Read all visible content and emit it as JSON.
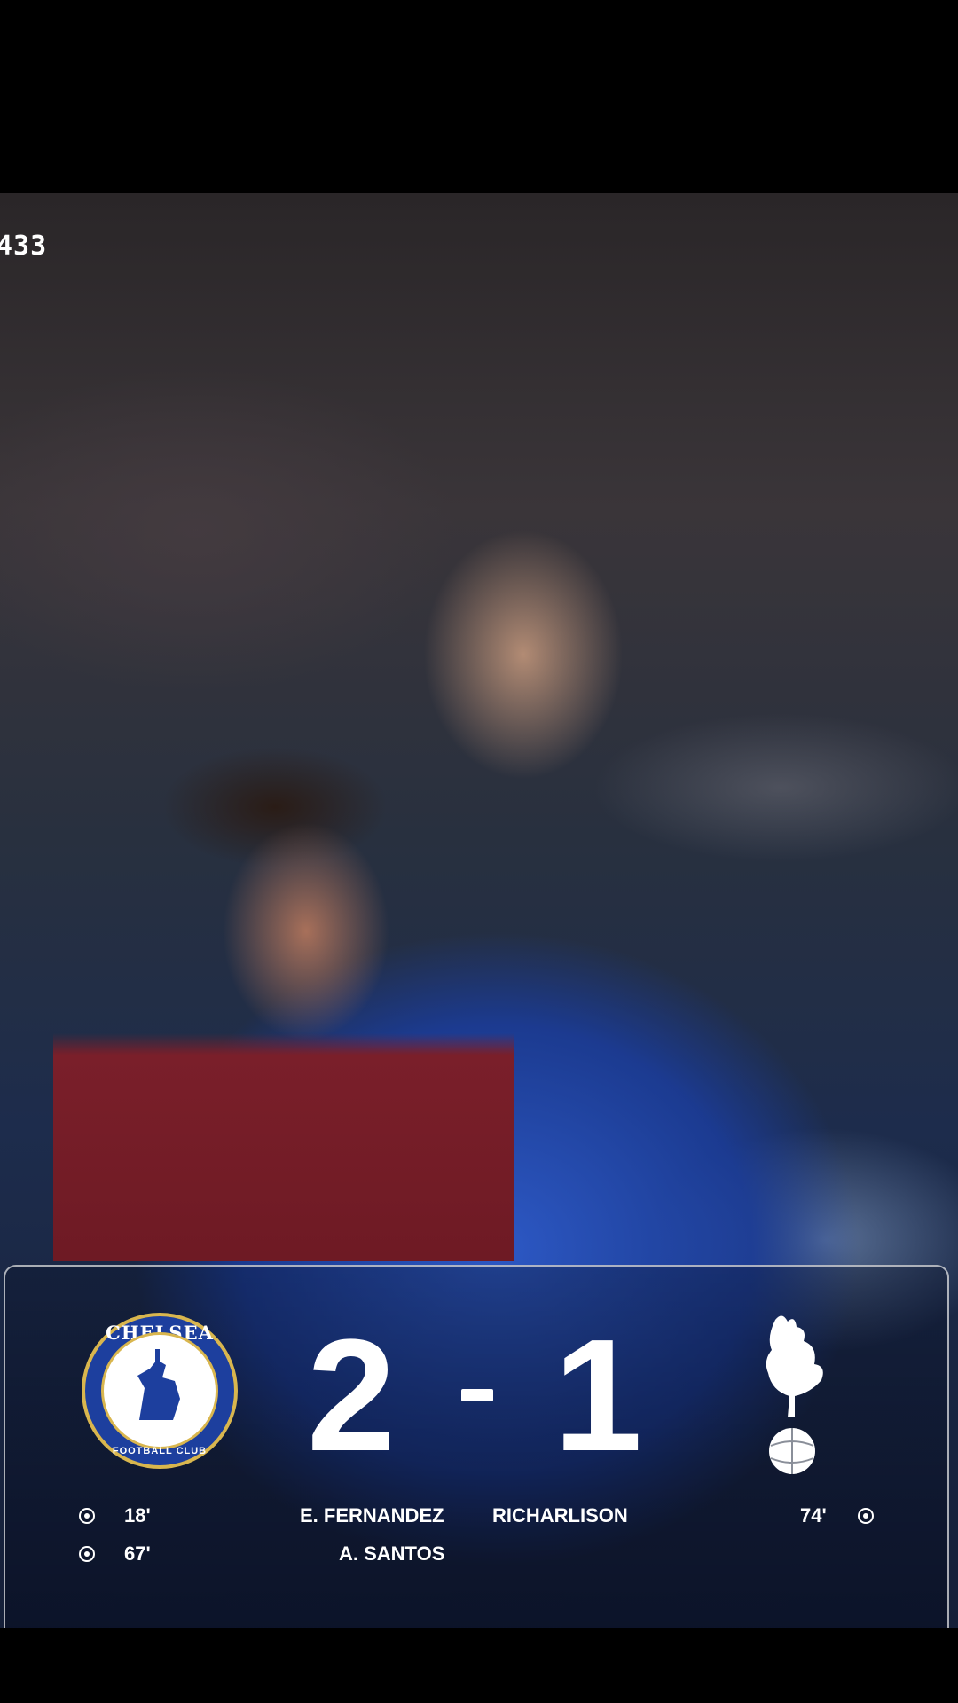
{
  "logo_mark": "433",
  "match": {
    "home": {
      "crest": "chelsea-crest",
      "crest_top": "CHELSEA",
      "crest_bottom": "FOOTBALL CLUB",
      "score": "2"
    },
    "away": {
      "crest": "tottenham-crest",
      "score": "1"
    },
    "home_scorers": [
      {
        "minute": "18'",
        "name": "E. FERNANDEZ"
      },
      {
        "minute": "67'",
        "name": "A. SANTOS"
      }
    ],
    "away_scorers": [
      {
        "minute": "74'",
        "name": "RICHARLISON"
      }
    ]
  },
  "colors": {
    "chelsea_blue": "#1d3f9e",
    "gold": "#d9b64e",
    "text": "#ffffff"
  }
}
